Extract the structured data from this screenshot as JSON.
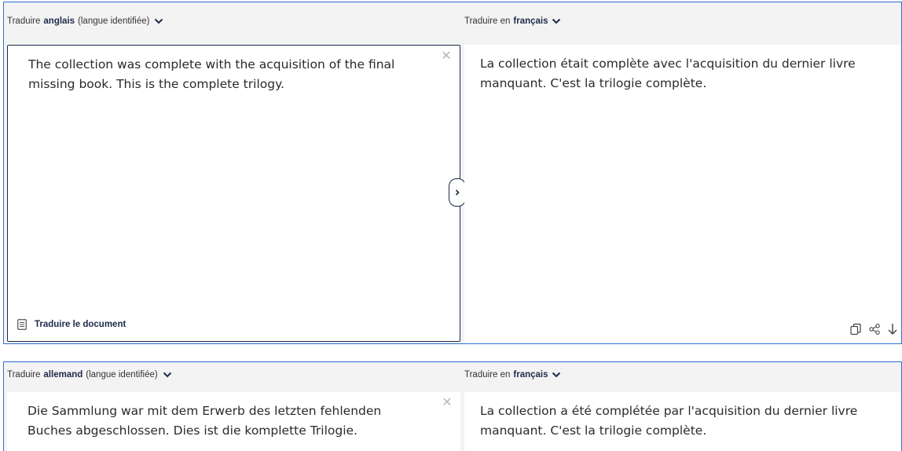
{
  "panel1": {
    "source_lang": {
      "prefix": "Traduire",
      "lang": "anglais",
      "suffix": "(langue identifiée)"
    },
    "target_lang": {
      "prefix": "Traduire en",
      "lang": "français"
    },
    "source_text": "The collection was complete with the acquisition of the final missing book. This is the complete trilogy.",
    "target_text": "La collection était complète avec l'acquisition du dernier livre manquant. C'est la trilogie complète.",
    "doc_button": "Traduire le document"
  },
  "panel2": {
    "source_lang": {
      "prefix": "Traduire",
      "lang": "allemand",
      "suffix": "(langue identifiée)"
    },
    "target_lang": {
      "prefix": "Traduire en",
      "lang": "français"
    },
    "source_text": "Die Sammlung war mit dem Erwerb des letzten fehlenden Buches abgeschlossen. Dies ist die komplette Trilogie.",
    "target_text": "La collection a été complétée par l'acquisition du dernier livre manquant. C'est la trilogie complète."
  },
  "icons": [
    "chevron-down-icon",
    "close-icon",
    "chevron-right-icon",
    "document-icon",
    "copy-icon",
    "share-icon",
    "download-icon"
  ],
  "colors": {
    "accent": "#2f6fcf",
    "dark": "#1d2a4a",
    "panel_bg": "#f3f3f3",
    "spell_underline": "#c0392b"
  }
}
